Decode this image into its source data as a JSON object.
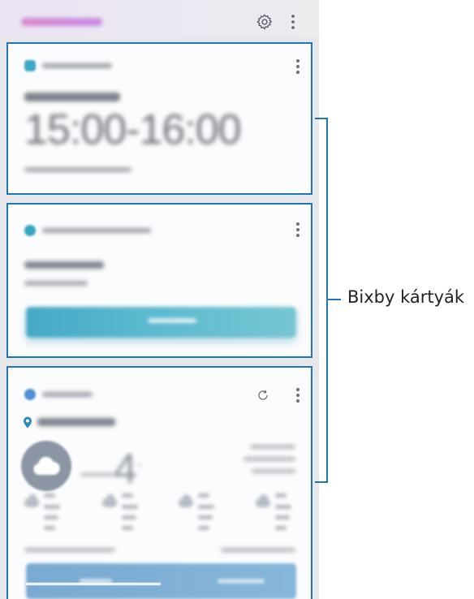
{
  "annotation": {
    "label": "Bixby kártyák",
    "color": "#2274b2"
  },
  "topbar": {
    "settings_icon": "gear-icon",
    "more_icon": "more-vertical-icon"
  },
  "cards": {
    "schedule": {
      "time_range": "15:00-16:00",
      "accent": "#3ba5c2"
    },
    "reminder": {
      "accent": "#3ba5c2"
    },
    "weather": {
      "icon": "cloud-icon",
      "refresh_icon": "refresh-icon",
      "location_icon": "location-pin-icon"
    }
  }
}
